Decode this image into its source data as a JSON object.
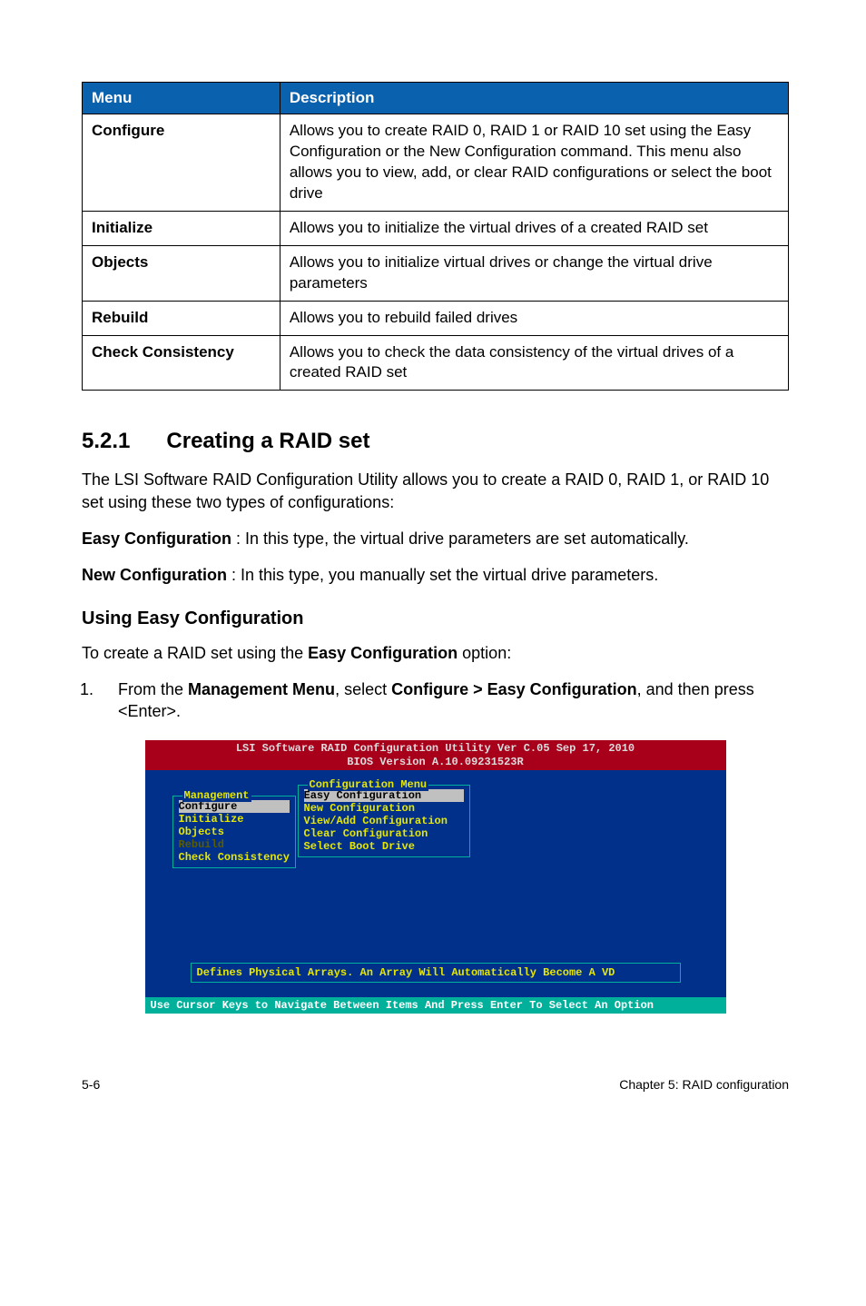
{
  "table": {
    "headers": [
      "Menu",
      "Description"
    ],
    "rows": [
      {
        "menu": "Configure",
        "desc": "Allows you to create RAID 0, RAID 1 or RAID 10 set using the Easy Configuration or the New Configuration command. This menu also allows you to view, add, or clear RAID configurations or select the boot drive"
      },
      {
        "menu": "Initialize",
        "desc": "Allows you to initialize the virtual drives of a created RAID set"
      },
      {
        "menu": "Objects",
        "desc": "Allows you to initialize virtual drives or change the virtual drive parameters"
      },
      {
        "menu": "Rebuild",
        "desc": "Allows you to rebuild failed drives"
      },
      {
        "menu": "Check Consistency",
        "desc": "Allows you to check the data consistency of the virtual drives of a created RAID set"
      }
    ]
  },
  "section": {
    "number": "5.2.1",
    "title": "Creating a RAID set"
  },
  "paras": {
    "intro": "The LSI Software RAID Configuration Utility allows you to create a RAID 0, RAID 1, or RAID 10 set using these two types of configurations:",
    "easy_label": "Easy Configuration",
    "easy_rest": " : In this type, the virtual drive parameters are set automatically.",
    "new_label": "New Configuration",
    "new_rest": " : In this type, you manually set the virtual drive parameters.",
    "using_heading": "Using Easy Configuration",
    "create_intro_a": "To create a RAID set using the ",
    "create_intro_b": "Easy Configuration",
    "create_intro_c": " option:",
    "step1_a": "From the ",
    "step1_b": "Management Menu",
    "step1_c": ", select ",
    "step1_d": "Configure > Easy Configuration",
    "step1_e": ", and then press <Enter>."
  },
  "bios": {
    "title_line1": "LSI Software RAID Configuration Utility Ver C.05 Sep 17, 2010",
    "title_line2": "BIOS Version   A.10.09231523R",
    "mgmt_label": "Management",
    "mgmt_items": [
      "Configure",
      "Initialize",
      "Objects",
      "Rebuild",
      "Check Consistency"
    ],
    "cfg_label": "Configuration Menu",
    "cfg_items": [
      "Easy Configuration",
      "New Configuration",
      "View/Add Configuration",
      "Clear Configuration",
      "Select Boot Drive"
    ],
    "hint": "Defines Physical Arrays. An Array Will Automatically Become A VD",
    "footer": "Use Cursor Keys to Navigate Between Items And Press Enter To Select An Option"
  },
  "footer": {
    "left": "5-6",
    "right": "Chapter 5: RAID configuration"
  }
}
